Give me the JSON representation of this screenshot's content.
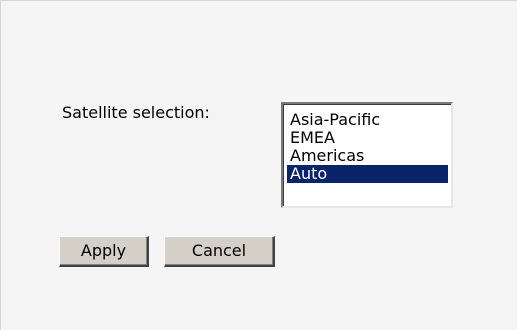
{
  "form": {
    "satellite_label": "Satellite selection:",
    "satellite_options": [
      "Asia-Pacific",
      "EMEA",
      "Americas",
      "Auto"
    ],
    "selected_option": "Auto"
  },
  "buttons": {
    "apply_label": "Apply",
    "cancel_label": "Cancel"
  },
  "colors": {
    "selection_background": "#0a246a",
    "selection_text": "#ffffff",
    "panel_background": "#f5f5f6",
    "button_face": "#d4d0c8"
  }
}
